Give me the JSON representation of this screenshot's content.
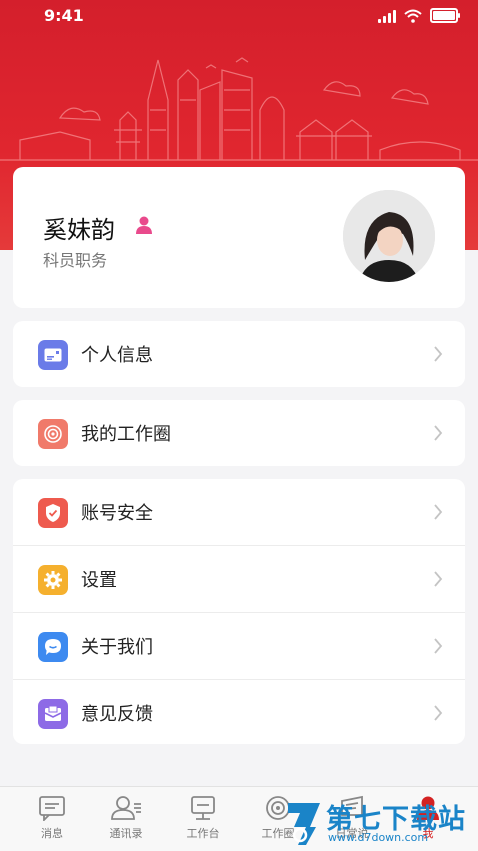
{
  "status_bar": {
    "time": "9:41"
  },
  "profile": {
    "name": "奚妹韵",
    "title": "科员职务"
  },
  "menu_groups": [
    [
      {
        "label": "个人信息",
        "icon": "id-card-icon",
        "color": "#6a7be8"
      }
    ],
    [
      {
        "label": "我的工作圈",
        "icon": "work-circle-icon",
        "color": "#f07a6a"
      }
    ],
    [
      {
        "label": "账号安全",
        "icon": "shield-icon",
        "color": "#ee5a4e"
      },
      {
        "label": "设置",
        "icon": "gear-icon",
        "color": "#f5b02e"
      },
      {
        "label": "关于我们",
        "icon": "chat-bubble-icon",
        "color": "#3d8af0"
      },
      {
        "label": "意见反馈",
        "icon": "feedback-mail-icon",
        "color": "#8d6ae6"
      }
    ]
  ],
  "tabbar": [
    {
      "label": "消息",
      "icon": "message-icon"
    },
    {
      "label": "通讯录",
      "icon": "contacts-icon"
    },
    {
      "label": "工作台",
      "icon": "workbench-icon"
    },
    {
      "label": "工作圈",
      "icon": "circle-icon"
    },
    {
      "label": "日常说",
      "icon": "daily-icon"
    },
    {
      "label": "我",
      "icon": "me-icon",
      "active": true
    }
  ],
  "watermark": {
    "text": "第七下载站",
    "url": "www.d7down.com"
  },
  "colors": {
    "brand_red": "#d41f2c",
    "background": "#f4f4f6"
  }
}
